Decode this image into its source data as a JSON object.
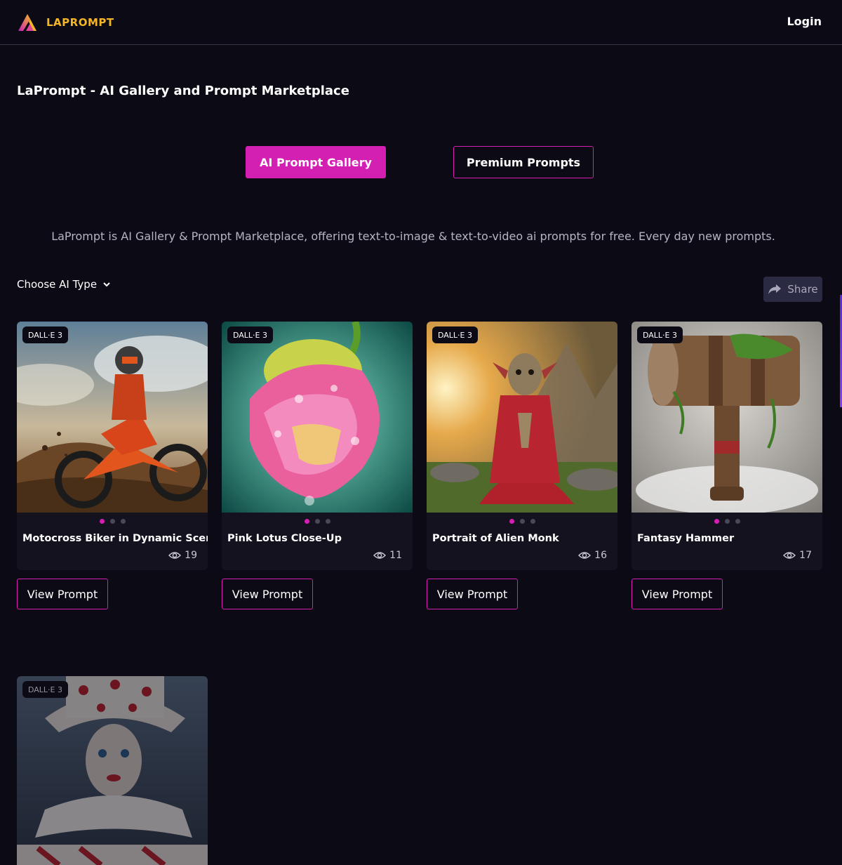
{
  "header": {
    "logo_text": "LAPROMPT",
    "login_label": "Login"
  },
  "page": {
    "title": "LaPrompt - AI Gallery and Prompt Marketplace",
    "tabs": [
      {
        "label": "AI Prompt Gallery",
        "active": true
      },
      {
        "label": "Premium Prompts",
        "active": false
      }
    ],
    "intro": "LaPrompt is AI Gallery & Prompt Marketplace, offering text-to-image & text-to-video ai prompts for free. Every day new prompts.",
    "filter_label": "Choose AI Type",
    "share_label": "Share"
  },
  "colors": {
    "accent": "#d41fb3",
    "background": "#0b0a15",
    "logo": "#f5b625"
  },
  "cards": [
    {
      "model": "DALL·E 3",
      "title": "Motocross Biker in Dynamic Scene",
      "views": "19",
      "button": "View Prompt",
      "active_slide": 1,
      "slides": 3
    },
    {
      "model": "DALL·E 3",
      "title": "Pink Lotus Close-Up",
      "views": "11",
      "button": "View Prompt",
      "active_slide": 1,
      "slides": 3
    },
    {
      "model": "DALL·E 3",
      "title": "Portrait of Alien Monk",
      "views": "16",
      "button": "View Prompt",
      "active_slide": 1,
      "slides": 3
    },
    {
      "model": "DALL·E 3",
      "title": "Fantasy Hammer",
      "views": "17",
      "button": "View Prompt",
      "active_slide": 1,
      "slides": 3
    },
    {
      "model": "DALL·E 3"
    }
  ]
}
